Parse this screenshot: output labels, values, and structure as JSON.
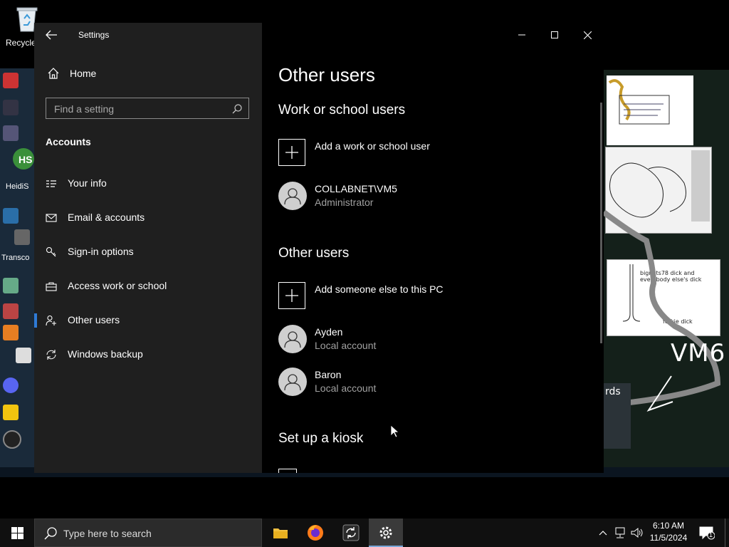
{
  "desktop": {
    "recycle_label": "Recycle",
    "vm6_label": "VM6",
    "cards_label": "rds",
    "vm_left_labels": [
      "HS",
      "HeidiS",
      "Transco"
    ],
    "paper3_text": "bignuts78 dick and everybody else's dick",
    "paper3_text2": "forkie dick"
  },
  "window": {
    "title": "Settings",
    "home_label": "Home",
    "search_placeholder": "Find a setting",
    "section_label": "Accounts",
    "nav": [
      {
        "label": "Your info",
        "icon": "contact-card-icon"
      },
      {
        "label": "Email & accounts",
        "icon": "mail-icon"
      },
      {
        "label": "Sign-in options",
        "icon": "key-icon"
      },
      {
        "label": "Access work or school",
        "icon": "briefcase-icon"
      },
      {
        "label": "Other users",
        "icon": "person-add-icon",
        "selected": true
      },
      {
        "label": "Windows backup",
        "icon": "sync-icon"
      }
    ]
  },
  "content": {
    "page_title": "Other users",
    "work_heading": "Work or school users",
    "add_work_user": "Add a work or school user",
    "work_users": [
      {
        "name": "COLLABNET\\VM5",
        "role": "Administrator"
      }
    ],
    "other_heading": "Other users",
    "add_other_user": "Add someone else to this PC",
    "other_users": [
      {
        "name": "Ayden",
        "role": "Local account"
      },
      {
        "name": "Baron",
        "role": "Local account"
      }
    ],
    "kiosk_heading": "Set up a kiosk"
  },
  "taskbar": {
    "search_placeholder": "Type here to search",
    "time": "6:10 AM",
    "date": "11/5/2024",
    "notification_count": "1",
    "apps": [
      "file-explorer-icon",
      "firefox-icon",
      "sync-app-icon",
      "settings-gear-icon"
    ],
    "accent": "#7aa7d8"
  }
}
